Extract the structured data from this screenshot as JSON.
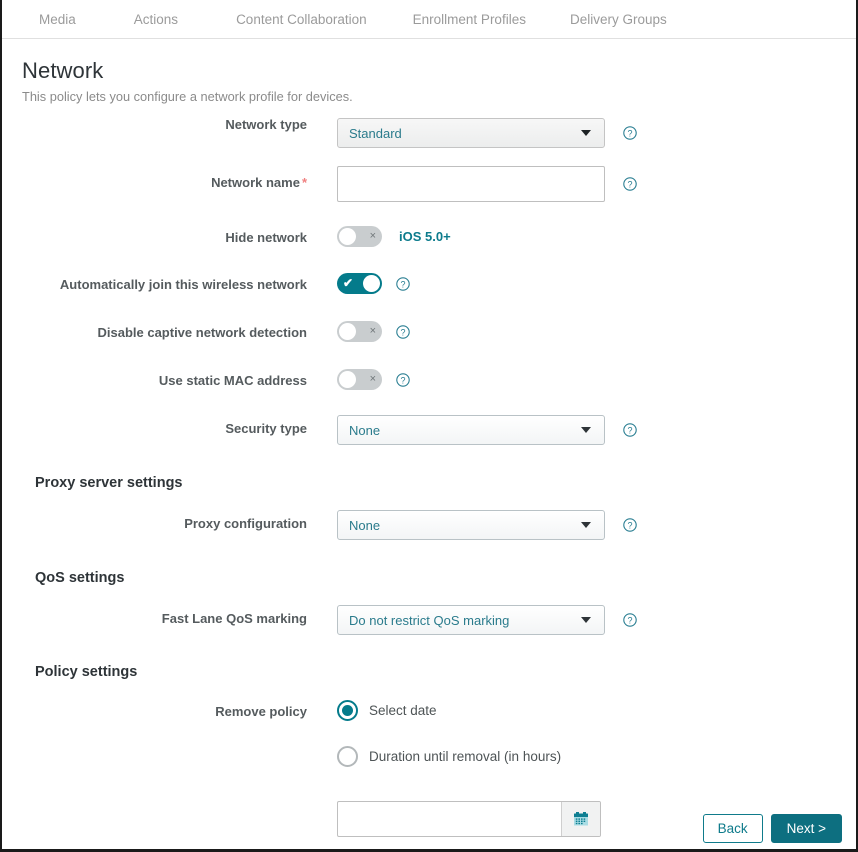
{
  "topnav": {
    "tabs": [
      {
        "label": "Media"
      },
      {
        "label": "Actions"
      },
      {
        "label": "Content Collaboration"
      },
      {
        "label": "Enrollment Profiles"
      },
      {
        "label": "Delivery Groups"
      }
    ]
  },
  "header": {
    "title": "Network",
    "description": "This policy lets you configure a network profile for devices."
  },
  "form": {
    "network_type": {
      "label": "Network type",
      "value": "Standard",
      "help": "?"
    },
    "network_name": {
      "label": "Network name",
      "required_marker": "*",
      "value": "",
      "placeholder": "",
      "help": "?"
    },
    "hide_network": {
      "label": "Hide network",
      "state": "off",
      "off_mark": "×",
      "badge": "iOS 5.0+"
    },
    "auto_join": {
      "label": "Automatically join this wireless network",
      "state": "on",
      "on_mark": "✔",
      "help": "?"
    },
    "disable_captive": {
      "label": "Disable captive network detection",
      "state": "off",
      "off_mark": "×",
      "help": "?"
    },
    "static_mac": {
      "label": "Use static MAC address",
      "state": "off",
      "off_mark": "×",
      "help": "?"
    },
    "security_type": {
      "label": "Security type",
      "value": "None",
      "help": "?"
    }
  },
  "proxy_section": {
    "heading": "Proxy server settings",
    "proxy_configuration": {
      "label": "Proxy configuration",
      "value": "None",
      "help": "?"
    }
  },
  "qos_section": {
    "heading": "QoS settings",
    "fast_lane": {
      "label": "Fast Lane QoS marking",
      "value": "Do not restrict QoS marking",
      "help": "?"
    }
  },
  "policy_section": {
    "heading": "Policy settings",
    "remove_policy": {
      "label": "Remove policy",
      "options": [
        {
          "label": "Select date",
          "selected": true
        },
        {
          "label": "Duration until removal (in hours)",
          "selected": false
        }
      ]
    },
    "date_field": {
      "value": "",
      "placeholder": "",
      "icon": "calendar-icon"
    }
  },
  "footer": {
    "back_label": "Back",
    "next_label": "Next >"
  },
  "colors": {
    "accent": "#047b8b",
    "accent_dark": "#0d6f80",
    "link": "#2a7b8c",
    "required": "#f08080",
    "label": "#555b5e"
  }
}
